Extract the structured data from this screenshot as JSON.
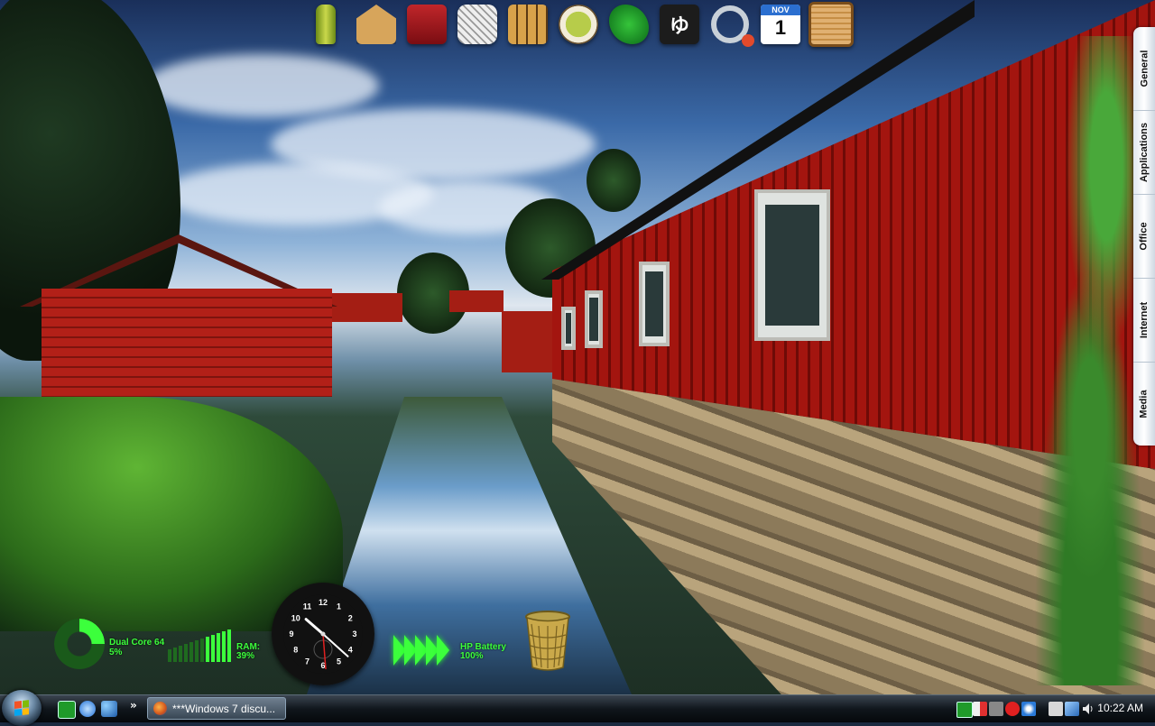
{
  "dock": {
    "items": [
      {
        "name": "bamboo",
        "icon": "bamboo-icon"
      },
      {
        "name": "ema",
        "icon": "ema-plaque-icon"
      },
      {
        "name": "jewelry-box",
        "icon": "red-box-icon"
      },
      {
        "name": "basket",
        "icon": "basket-icon"
      },
      {
        "name": "shoji",
        "icon": "shoji-screen-icon"
      },
      {
        "name": "tea",
        "icon": "tea-cup-icon"
      },
      {
        "name": "lizard",
        "icon": "green-lizard-icon"
      },
      {
        "name": "yu",
        "icon": "yu-character-icon",
        "glyph": "ゆ"
      },
      {
        "name": "ring",
        "icon": "ring-icon"
      },
      {
        "name": "calendar",
        "icon": "calendar-icon",
        "month": "NOV",
        "day": "1"
      },
      {
        "name": "board",
        "icon": "wood-board-icon"
      }
    ]
  },
  "drawer": {
    "tabs": [
      "General",
      "Applications",
      "Office",
      "Internet",
      "Media"
    ]
  },
  "gadgets": {
    "cpu": {
      "label": "Dual Core 64",
      "value": "5%",
      "fraction": 0.05
    },
    "ram": {
      "label": "RAM:",
      "value": "39%",
      "fraction": 0.39
    },
    "clock": {
      "hour": 10,
      "minute": 22,
      "numerals": [
        "12",
        "1",
        "2",
        "3",
        "4",
        "5",
        "6",
        "7",
        "8",
        "9",
        "10",
        "11"
      ]
    },
    "battery": {
      "label": "HP Battery",
      "value": "100%",
      "fraction": 1.0
    }
  },
  "taskbar": {
    "chevron": "»",
    "task_label": "***Windows 7 discu...",
    "clock": "10:22 AM"
  },
  "colors": {
    "gadget_green": "#3cff3c",
    "barn_red": "#a3150f"
  }
}
